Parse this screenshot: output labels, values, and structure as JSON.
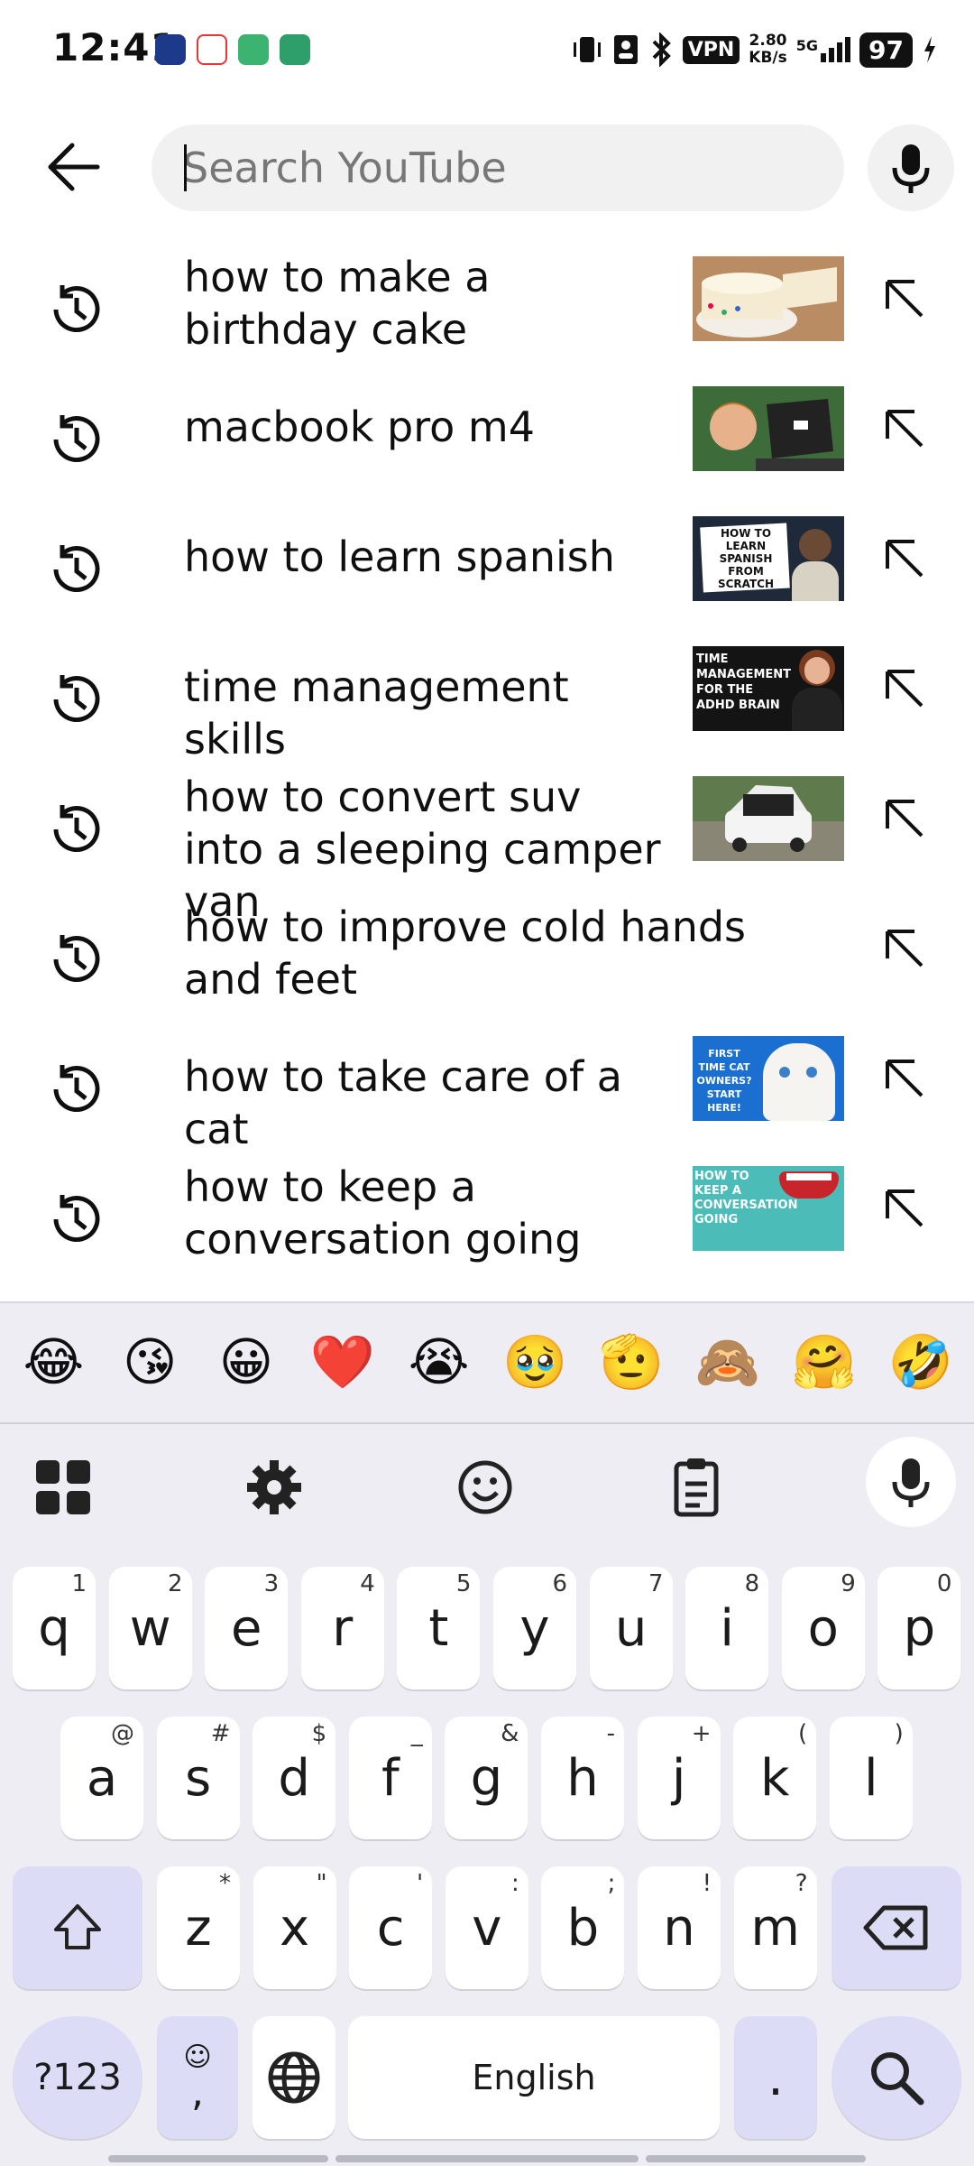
{
  "status_bar": {
    "time": "12:41",
    "vpn": "VPN",
    "speed_value": "2.80",
    "speed_unit": "KB/s",
    "network": "5G",
    "battery": "97"
  },
  "search": {
    "placeholder": "Search YouTube"
  },
  "suggestions": [
    {
      "text": "how to make a birthday cake",
      "has_thumb": true
    },
    {
      "text": "macbook pro m4",
      "has_thumb": true
    },
    {
      "text": "how to learn spanish",
      "has_thumb": true,
      "thumb_text": "HOW TO LEARN SPANISH FROM SCRATCH"
    },
    {
      "text": "time management skills",
      "has_thumb": true,
      "thumb_text": "TIME MANAGEMENT FOR THE ADHD BRAIN"
    },
    {
      "text": "how to convert suv into a sleeping camper van",
      "has_thumb": true
    },
    {
      "text": "how to improve cold hands and feet",
      "has_thumb": false
    },
    {
      "text": "how to take care of a cat",
      "has_thumb": true,
      "thumb_text": "FIRST TIME CAT OWNERS? START HERE!"
    },
    {
      "text": "how to keep a conversation going",
      "has_thumb": true,
      "thumb_text": "HOW TO KEEP A CONVERSATION GOING"
    }
  ],
  "keyboard": {
    "emojis": [
      "😂",
      "😘",
      "😀",
      "❤️",
      "😭",
      "🥹",
      "🫡",
      "🙈",
      "🤗",
      "🤣"
    ],
    "row1": [
      {
        "k": "q",
        "a": "1"
      },
      {
        "k": "w",
        "a": "2"
      },
      {
        "k": "e",
        "a": "3"
      },
      {
        "k": "r",
        "a": "4"
      },
      {
        "k": "t",
        "a": "5"
      },
      {
        "k": "y",
        "a": "6"
      },
      {
        "k": "u",
        "a": "7"
      },
      {
        "k": "i",
        "a": "8"
      },
      {
        "k": "o",
        "a": "9"
      },
      {
        "k": "p",
        "a": "0"
      }
    ],
    "row2": [
      {
        "k": "a",
        "a": "@"
      },
      {
        "k": "s",
        "a": "#"
      },
      {
        "k": "d",
        "a": "$"
      },
      {
        "k": "f",
        "a": "_"
      },
      {
        "k": "g",
        "a": "&"
      },
      {
        "k": "h",
        "a": "-"
      },
      {
        "k": "j",
        "a": "+"
      },
      {
        "k": "k",
        "a": "("
      },
      {
        "k": "l",
        "a": ")"
      }
    ],
    "row3": [
      {
        "k": "z",
        "a": "*"
      },
      {
        "k": "x",
        "a": "\""
      },
      {
        "k": "c",
        "a": "'"
      },
      {
        "k": "v",
        "a": ":"
      },
      {
        "k": "b",
        "a": ";"
      },
      {
        "k": "n",
        "a": "!"
      },
      {
        "k": "m",
        "a": "?"
      }
    ],
    "symbols_label": "?123",
    "comma_label": ",",
    "space_label": "English",
    "period_label": "."
  },
  "colors": {
    "keyboard_bg": "#eeedf4",
    "modifier_key": "#dcdcf6",
    "search_bg": "#f1f1f1"
  }
}
